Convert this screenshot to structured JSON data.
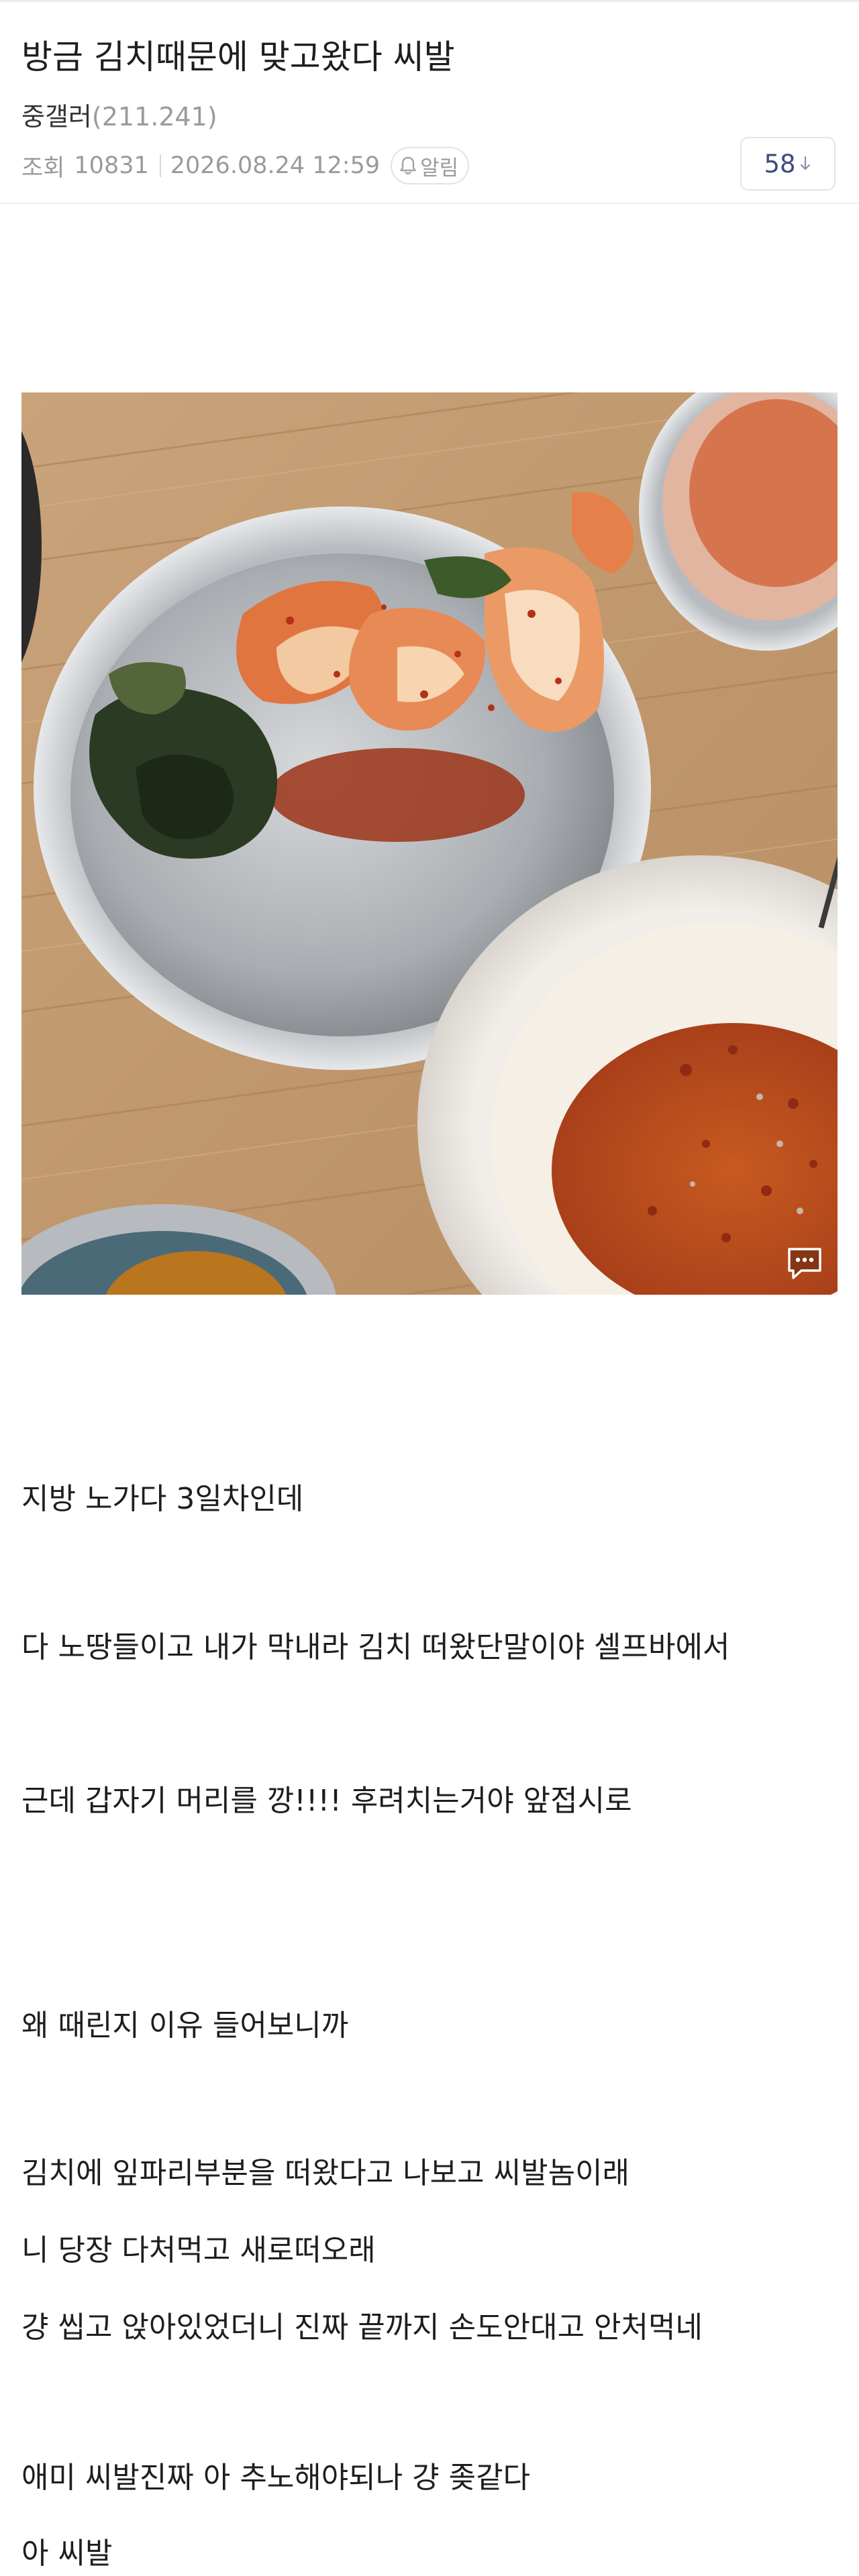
{
  "post": {
    "title": "방금 김치때문에 맞고왔다 씨발",
    "author_name": "중갤러",
    "author_ip": "(211.241)",
    "views_label": "조회",
    "views": "10831",
    "date": "2026.08.24 12:59",
    "alarm_label": "알림",
    "comment_count": "58"
  },
  "body": {
    "lines": [
      "지방 노가다 3일차인데",
      "다 노땅들이고 내가 막내라 김치 떠왔단말이야 셀프바에서",
      "근데 갑자기 머리를 깡!!!! 후려치는거야 앞접시로",
      "왜 때린지 이유 들어보니까",
      "김치에 잎파리부분을 떠왔다고 나보고 씨발놈이래",
      "니 당장 다처먹고 새로떠오래",
      "걍 씹고 앉아있었더니 진짜 끝까지 손도안대고 안처먹네",
      "애미 씨발진짜 아 추노해야되나 걍 좆같다",
      "아 씨발"
    ]
  },
  "icons": {
    "bell": "bell-icon",
    "arrow": "arrow-down-icon",
    "comment": "comment-bubble-icon"
  },
  "colors": {
    "comment_count": "#3e4a7e",
    "meta_gray": "#9a9a9a"
  }
}
